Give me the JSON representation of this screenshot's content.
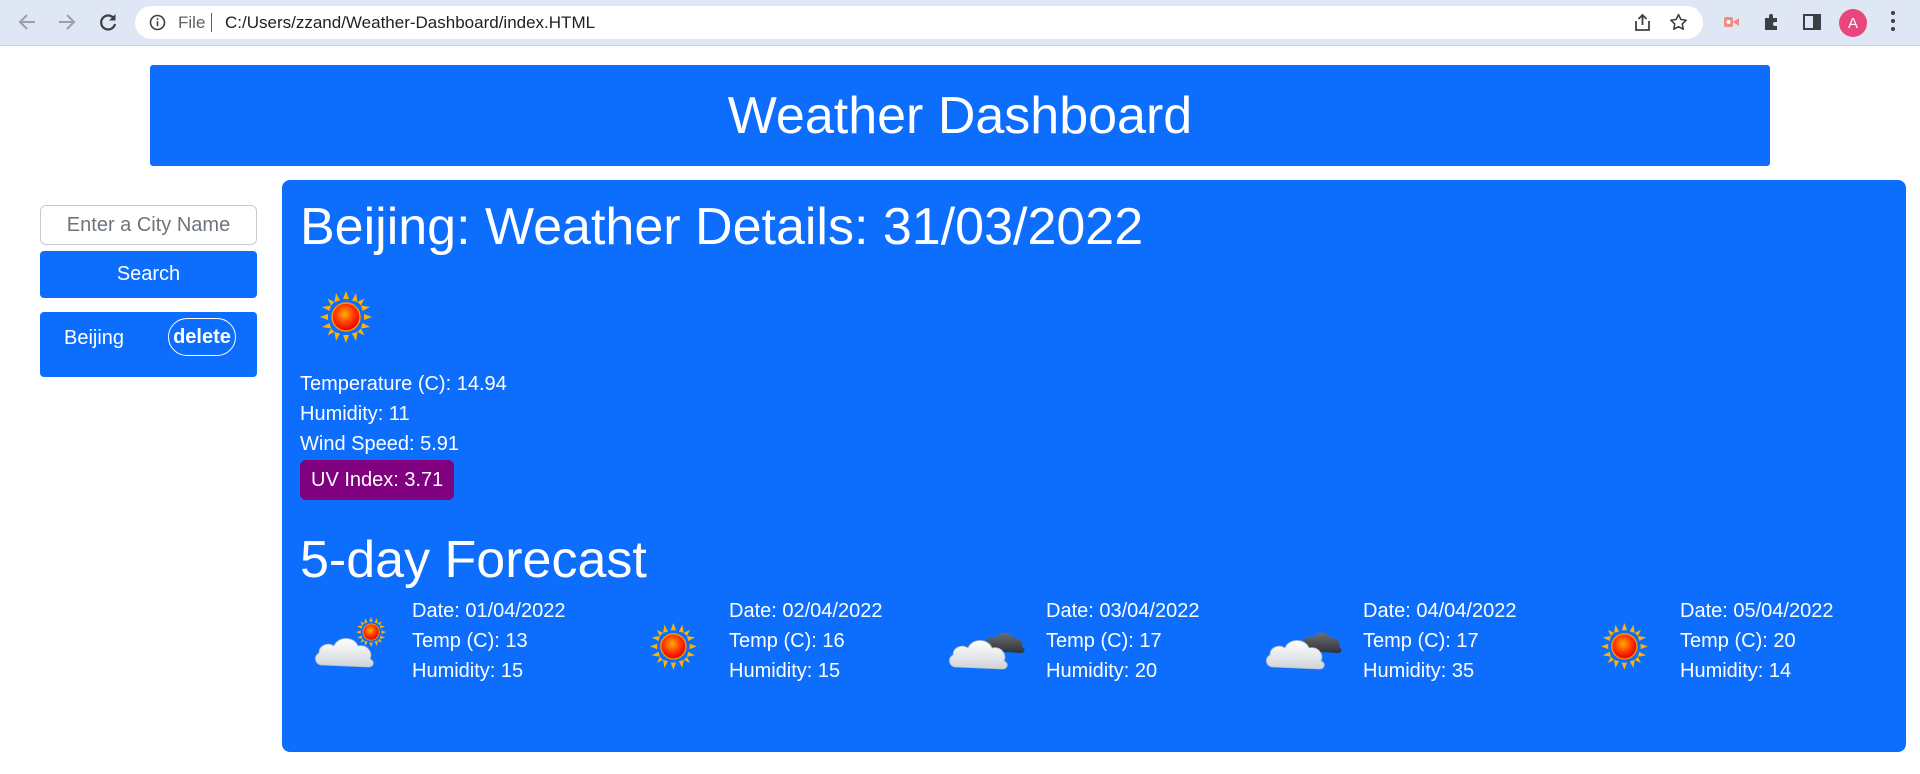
{
  "browser": {
    "file_label": "File",
    "url": "C:/Users/zzand/Weather-Dashboard/index.HTML",
    "profile_initial": "A"
  },
  "header": {
    "title": "Weather Dashboard"
  },
  "sidebar": {
    "search_placeholder": "Enter a City Name",
    "search_value": "",
    "search_label": "Search",
    "history": [
      {
        "city": "Beijing",
        "delete_label": "delete"
      }
    ]
  },
  "current": {
    "title": "Beijing: Weather Details: 31/03/2022",
    "icon": "sun-icon",
    "temperature": "Temperature (C): 14.94",
    "humidity": "Humidity: 11",
    "wind": "Wind Speed: 5.91",
    "uv": "UV Index: 3.71",
    "uv_color": "#800080"
  },
  "forecast": {
    "title": "5-day Forecast",
    "days": [
      {
        "date": "Date: 01/04/2022",
        "temp": "Temp (C): 13",
        "humidity": "Humidity: 15",
        "icon": "cloud-sun-icon"
      },
      {
        "date": "Date: 02/04/2022",
        "temp": "Temp (C): 16",
        "humidity": "Humidity: 15",
        "icon": "sun-icon"
      },
      {
        "date": "Date: 03/04/2022",
        "temp": "Temp (C): 17",
        "humidity": "Humidity: 20",
        "icon": "cloud-overcast-icon"
      },
      {
        "date": "Date: 04/04/2022",
        "temp": "Temp (C): 17",
        "humidity": "Humidity: 35",
        "icon": "cloud-overcast-icon"
      },
      {
        "date": "Date: 05/04/2022",
        "temp": "Temp (C): 20",
        "humidity": "Humidity: 14",
        "icon": "sun-icon"
      }
    ]
  },
  "colors": {
    "primary": "#0d6efd",
    "uv": "#800080",
    "chrome": "#dfe7f5"
  }
}
